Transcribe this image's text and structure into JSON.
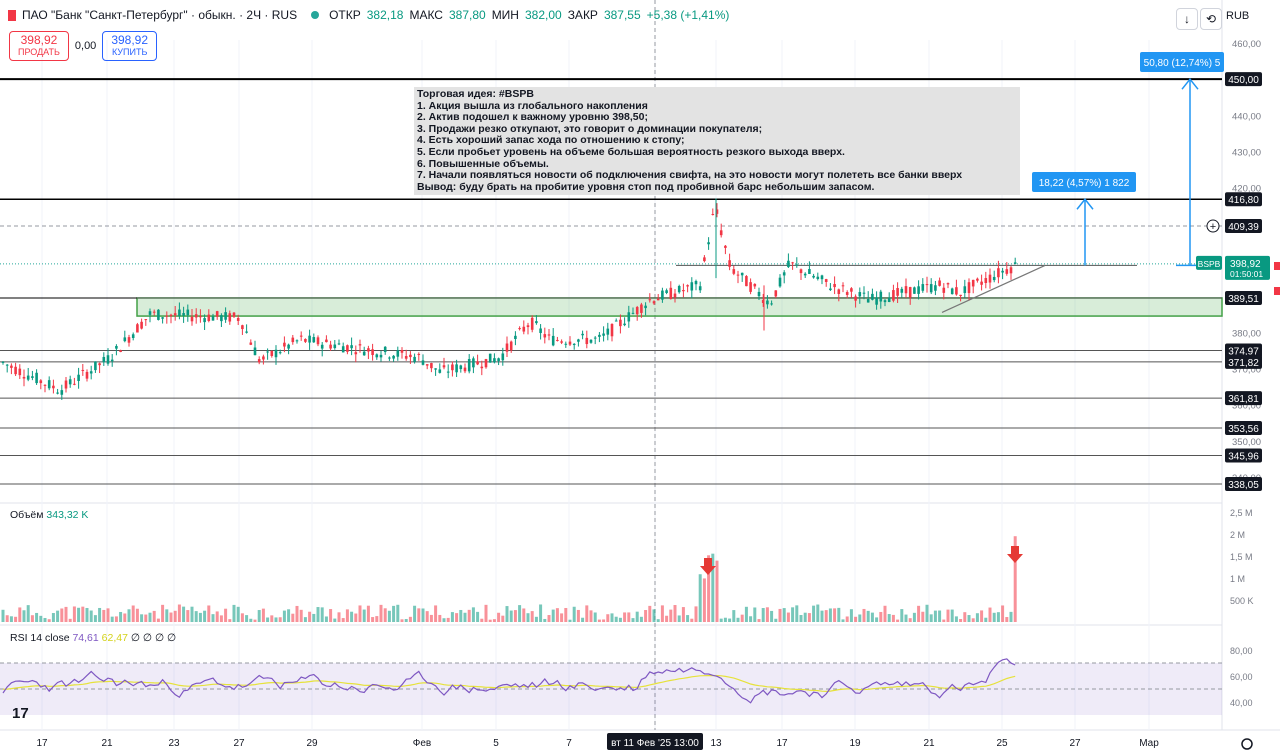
{
  "header": {
    "title": "ПАО \"Банк \"Санкт-Петербург\" · обыкн. · 2Ч · RUS",
    "open_label": "ОТКР",
    "open_value": "382,18",
    "high_label": "МАКС",
    "high_value": "387,80",
    "low_label": "МИН",
    "low_value": "382,00",
    "close_label": "ЗАКР",
    "close_value": "387,55",
    "change": "+5,38 (+1,41%)"
  },
  "trade": {
    "sell_price": "398,92",
    "sell_label": "ПРОДАТЬ",
    "spread": "0,00",
    "buy_price": "398,92",
    "buy_label": "КУПИТЬ"
  },
  "toolbar": {
    "currency": "RUB",
    "down_icon": "↓",
    "reset_icon": "⟲"
  },
  "note": {
    "lines": [
      "Торговая идея: #BSPB",
      "1. Акция вышла из глобального накопления",
      "2. Актив подошел к важному уровню 398,50;",
      "3. Продажи резко откупают, это говорит о доминации покупателя;",
      "4. Есть хороший запас хода по отношению к стопу;",
      "5. Если пробьет уровень на объеме большая вероятность резкого выхода вверх.",
      "6. Повышенные объемы.",
      "7. Начали появляться новости об подключения свифта, на это новости могут полететь все банки вверх",
      "Вывод: буду брать на пробитие уровня стоп под пробивной барс небольшим запасом."
    ]
  },
  "measure": {
    "big": "50,80 (12,74%) 5",
    "small": "18,22 (4,57%) 1 822"
  },
  "volume": {
    "label": "Объём",
    "value": "343,32 K"
  },
  "rsi": {
    "label": "RSI 14 close",
    "value1": "74,61",
    "value2": "62,47",
    "extra": "∅ ∅ ∅ ∅"
  },
  "chart_data": {
    "type": "candlestick",
    "symbol": "BSPB",
    "last_price": "398,92",
    "countdown": "01:50:01",
    "price_axis": [
      "460,00",
      "450,00",
      "440,00",
      "430,00",
      "420,00",
      "410,00",
      "400,00",
      "390,00",
      "380,00",
      "370,00",
      "360,00",
      "350,00",
      "340,00"
    ],
    "level_labels": [
      "450,00",
      "416,80",
      "409,39",
      "389,51",
      "374,97",
      "371,82",
      "361,81",
      "353,56",
      "345,96",
      "338,05"
    ],
    "volume_axis": [
      "2,5 M",
      "2 M",
      "1,5 M",
      "1 M",
      "500 K"
    ],
    "rsi_axis": [
      "80,00",
      "60,00",
      "40,00"
    ],
    "time_labels": [
      "17",
      "21",
      "23",
      "27",
      "29",
      "Фев",
      "5",
      "7",
      "вт 11 Фев '25  13:00",
      "13",
      "17",
      "19",
      "21",
      "25",
      "27",
      "Мар"
    ],
    "crosshair_time": "вт 11 Фев '25  13:00",
    "y_range": [
      335,
      465
    ],
    "rsi_range": [
      30,
      85
    ]
  }
}
